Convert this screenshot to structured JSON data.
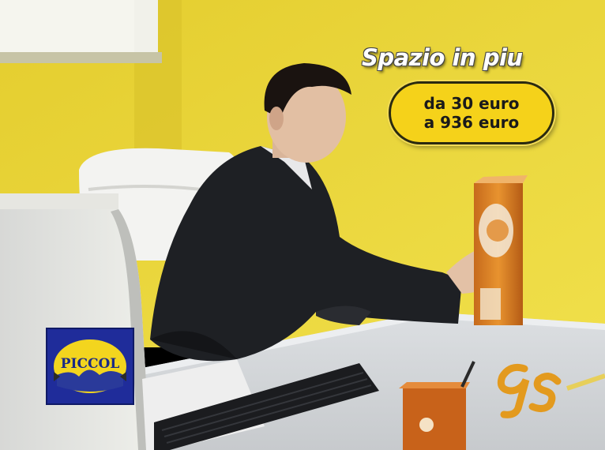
{
  "scene": {
    "description_icon": "office-desk-photo",
    "wall_color": "#e9d63a"
  },
  "overlay": {
    "headline": "Spazio in piu",
    "price_line_1": "da 30 euro",
    "price_line_2": "a 936 euro",
    "pill_color": "#f5d21a"
  },
  "logo": {
    "text": "PICCOL",
    "background": "#1f2c9a",
    "accent": "#f3d51e"
  },
  "corner_mark": {
    "icon": "broadcaster-logo-icon",
    "color": "#e39a1e"
  }
}
